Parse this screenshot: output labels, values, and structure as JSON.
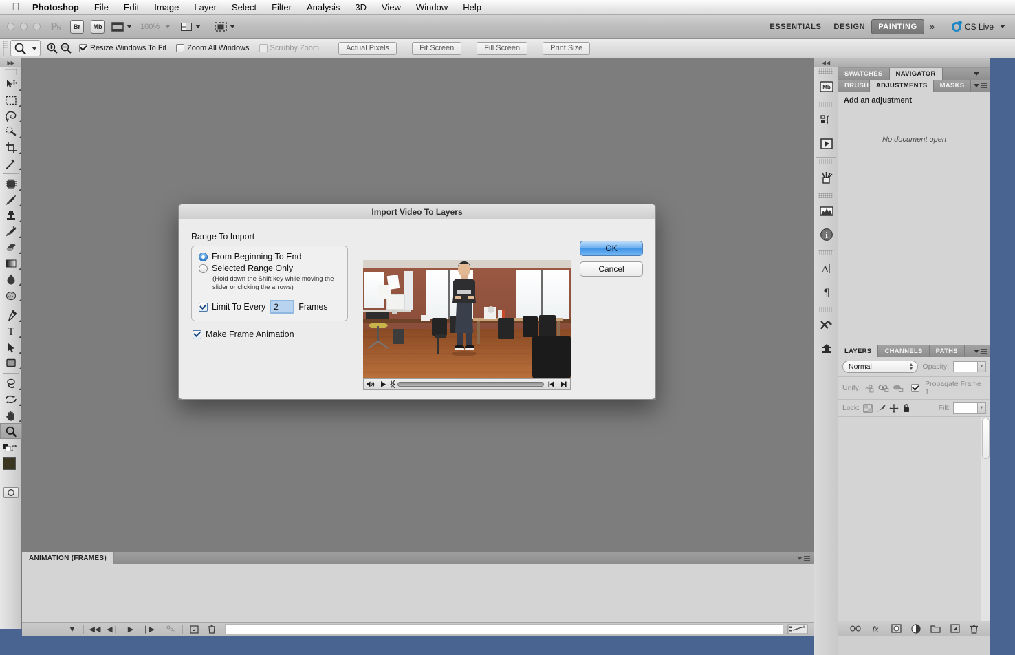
{
  "menubar": {
    "apple_icon": "apple-icon",
    "items": [
      {
        "label": "Photoshop",
        "bold": true
      },
      {
        "label": "File",
        "bold": false
      },
      {
        "label": "Edit",
        "bold": false
      },
      {
        "label": "Image",
        "bold": false
      },
      {
        "label": "Layer",
        "bold": false
      },
      {
        "label": "Select",
        "bold": false
      },
      {
        "label": "Filter",
        "bold": false
      },
      {
        "label": "Analysis",
        "bold": false
      },
      {
        "label": "3D",
        "bold": false
      },
      {
        "label": "View",
        "bold": false
      },
      {
        "label": "Window",
        "bold": false
      },
      {
        "label": "Help",
        "bold": false
      }
    ]
  },
  "appbar": {
    "ps_logo": "Ps",
    "bridge_label": "Br",
    "minibridge_label": "Mb",
    "zoom_level": "100%",
    "workspaces": [
      {
        "label": "ESSENTIALS",
        "active": false
      },
      {
        "label": "DESIGN",
        "active": false
      },
      {
        "label": "PAINTING",
        "active": true
      }
    ],
    "more_label": "»",
    "cs_live_label": "CS Live"
  },
  "optionsbar": {
    "tool_icon": "zoom-tool-icon",
    "zoom_in_icon": "zoom-in-icon",
    "zoom_out_icon": "zoom-out-icon",
    "checkboxes": [
      {
        "label": "Resize Windows To Fit",
        "checked": true,
        "enabled": true
      },
      {
        "label": "Zoom All Windows",
        "checked": false,
        "enabled": true
      },
      {
        "label": "Scrubby Zoom",
        "checked": false,
        "enabled": false
      }
    ],
    "buttons": [
      "Actual Pixels",
      "Fit Screen",
      "Fill Screen",
      "Print Size"
    ]
  },
  "toolbar": {
    "tools": [
      {
        "name": "move-tool",
        "selected": false
      },
      {
        "name": "rectangular-marquee-tool",
        "selected": false
      },
      {
        "name": "lasso-tool",
        "selected": false
      },
      {
        "name": "quick-selection-tool",
        "selected": false
      },
      {
        "name": "crop-tool",
        "selected": false
      },
      {
        "name": "eyedropper-tool",
        "selected": false
      },
      {
        "name": "spot-healing-brush-tool",
        "selected": false
      },
      {
        "name": "brush-tool",
        "selected": false
      },
      {
        "name": "clone-stamp-tool",
        "selected": false
      },
      {
        "name": "history-brush-tool",
        "selected": false
      },
      {
        "name": "eraser-tool",
        "selected": false
      },
      {
        "name": "gradient-tool",
        "selected": false
      },
      {
        "name": "blur-tool",
        "selected": false
      },
      {
        "name": "dodge-tool",
        "selected": false
      },
      {
        "name": "pen-tool",
        "selected": false
      },
      {
        "name": "horizontal-type-tool",
        "selected": false
      },
      {
        "name": "path-selection-tool",
        "selected": false
      },
      {
        "name": "rectangle-tool",
        "selected": false
      },
      {
        "name": "3d-rotate-tool",
        "selected": false
      },
      {
        "name": "3d-orbit-tool",
        "selected": false
      },
      {
        "name": "hand-tool",
        "selected": false
      },
      {
        "name": "zoom-tool",
        "selected": true
      }
    ],
    "foreground_color": "#3a3622",
    "background_color": "#ffffff",
    "quick_mask_icon": "quick-mask-icon"
  },
  "dialog": {
    "title": "Import Video To Layers",
    "group_label": "Range To Import",
    "radio_options": [
      {
        "label": "From Beginning To End",
        "selected": true
      },
      {
        "label": "Selected Range Only",
        "selected": false
      }
    ],
    "hint": "(Hold down the Shift key while moving the slider or clicking the arrows)",
    "limit_label": "Limit To Every",
    "limit_value": "2",
    "frames_label": "Frames",
    "limit_checked": true,
    "make_frame_animation_label": "Make Frame Animation",
    "make_frame_animation_checked": true,
    "ok_label": "OK",
    "cancel_label": "Cancel",
    "preview": {
      "speaker_icon": "speaker-icon",
      "play_icon": "play-icon",
      "step_back_icon": "step-backward-icon",
      "step_forward_icon": "step-forward-icon",
      "scrubber_icon": "scrubber-handle-icon"
    }
  },
  "animation_panel": {
    "tab_label": "ANIMATION (FRAMES)",
    "menu_icon": "panel-menu-icon",
    "controls": [
      {
        "name": "looping-options-dropdown",
        "glyph": "▼"
      },
      {
        "name": "select-first-frame-button",
        "glyph": "◀◀"
      },
      {
        "name": "select-previous-frame-button",
        "glyph": "◀❘"
      },
      {
        "name": "play-animation-button",
        "glyph": "▶"
      },
      {
        "name": "select-next-frame-button",
        "glyph": "❘▶"
      },
      {
        "name": "tween-frames-button",
        "glyph": "⚭"
      },
      {
        "name": "duplicate-frame-button",
        "glyph": "⧉"
      },
      {
        "name": "delete-frame-button",
        "glyph": "Ὕ1"
      }
    ],
    "convert_timeline_icon": "convert-to-timeline-icon"
  },
  "dock": {
    "icons": [
      "mini-bridge-icon",
      "history-icon",
      "actions-icon",
      "brush-presets-icon",
      "histogram-icon",
      "info-icon",
      "character-icon",
      "paragraph-icon",
      "tool-presets-icon",
      "clone-source-icon"
    ]
  },
  "right_panels": {
    "top_group": {
      "tabs": [
        {
          "label": "SWATCHES",
          "active": false
        },
        {
          "label": "NAVIGATOR",
          "active": true
        }
      ]
    },
    "adjust_group": {
      "tabs": [
        {
          "label": "BRUSH PR",
          "active": false
        },
        {
          "label": "ADJUSTMENTS",
          "active": true
        },
        {
          "label": "MASKS",
          "active": false
        }
      ],
      "title": "Add an adjustment",
      "empty_message": "No document open"
    },
    "layers_group": {
      "tabs": [
        {
          "label": "LAYERS",
          "active": true
        },
        {
          "label": "CHANNELS",
          "active": false
        },
        {
          "label": "PATHS",
          "active": false
        }
      ],
      "blend_mode": "Normal",
      "opacity_label": "Opacity:",
      "opacity_value": "",
      "unify_label": "Unify:",
      "propagate_label": "Propagate Frame 1",
      "propagate_checked": true,
      "lock_label": "Lock:",
      "fill_label": "Fill:",
      "fill_value": "",
      "lock_icons": [
        "lock-transparent-pixels-icon",
        "lock-image-pixels-icon",
        "lock-position-icon",
        "lock-all-icon"
      ],
      "unify_icons": [
        "unify-position-icon",
        "unify-visibility-icon",
        "unify-style-icon"
      ],
      "footer_icons": [
        "link-layers-icon",
        "layer-style-icon",
        "layer-mask-icon",
        "new-adjustment-layer-icon",
        "new-group-icon",
        "new-layer-icon",
        "delete-layer-icon"
      ]
    }
  },
  "colors": {
    "desktop": "#4a6491",
    "canvas": "#7d7d7d",
    "panel": "#d4d4d4",
    "accent_blue": "#3f93e6"
  }
}
